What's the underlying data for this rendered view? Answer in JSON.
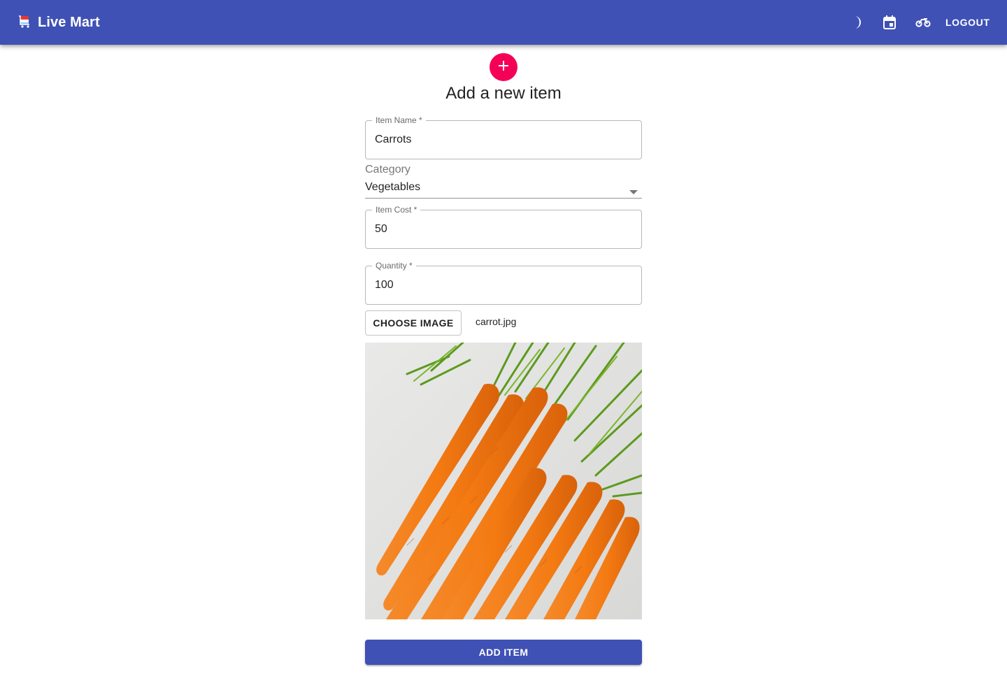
{
  "app": {
    "title": "Live Mart"
  },
  "header": {
    "icons": [
      "dark-mode-moon-icon",
      "calendar-icon",
      "delivery-bike-icon"
    ],
    "logout_label": "LOGOUT",
    "color": "#3f51b5"
  },
  "form": {
    "title": "Add a new item",
    "fab_icon": "add-icon",
    "fab_color": "#f50057",
    "item_name": {
      "label": "Item Name *",
      "value": "Carrots"
    },
    "category": {
      "label": "Category",
      "value": "Vegetables"
    },
    "item_cost": {
      "label": "Item Cost *",
      "value": "50"
    },
    "quantity": {
      "label": "Quantity *",
      "value": "100"
    },
    "choose_image_label": "CHOOSE IMAGE",
    "filename": "carrot.jpg",
    "submit_label": "ADD ITEM"
  }
}
